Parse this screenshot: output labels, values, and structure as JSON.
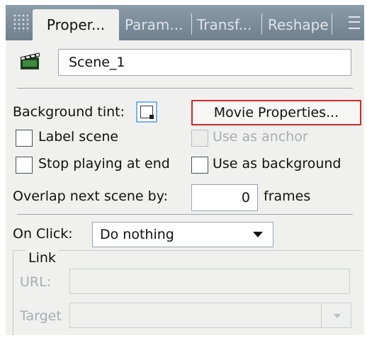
{
  "tabs": [
    {
      "label": "Proper...",
      "active": true
    },
    {
      "label": "Param...",
      "active": false
    },
    {
      "label": "Transf...",
      "active": false
    },
    {
      "label": "Reshape",
      "active": false
    }
  ],
  "scene": {
    "name": "Scene_1"
  },
  "background_tint": {
    "label": "Background tint:"
  },
  "movie_properties": {
    "label": "Movie Properties..."
  },
  "checkboxes": {
    "label_scene": {
      "label": "Label scene",
      "checked": false
    },
    "use_as_anchor": {
      "label": "Use as anchor",
      "checked": false,
      "disabled": true
    },
    "stop_playing": {
      "label": "Stop playing at end",
      "checked": false
    },
    "use_as_background": {
      "label": "Use as background",
      "checked": false
    }
  },
  "overlap": {
    "label": "Overlap next scene by:",
    "value": "0",
    "unit": "frames"
  },
  "on_click": {
    "label": "On Click:",
    "selected": "Do nothing"
  },
  "link": {
    "group_label": "Link",
    "url_label": "URL:",
    "url_value": "",
    "target_label": "Target",
    "target_value": ""
  },
  "colors": {
    "highlight": "#cf2a2a",
    "tab_bar": "#7f8f9c",
    "panel": "#f0f0ee"
  }
}
